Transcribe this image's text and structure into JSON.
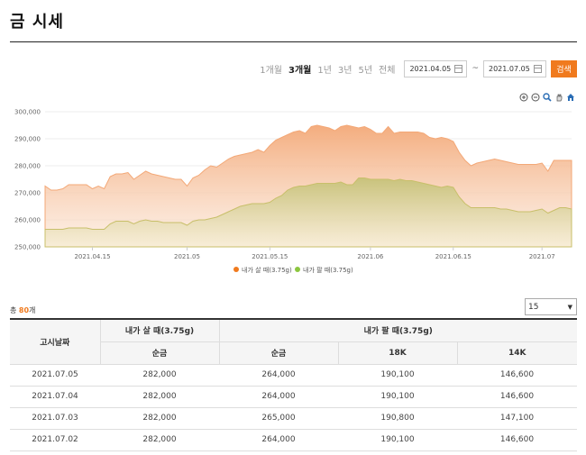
{
  "page": {
    "title": "금 시세"
  },
  "range": {
    "periods": [
      "1개월",
      "3개월",
      "1년",
      "3년",
      "5년",
      "전체"
    ],
    "active_period": "3개월",
    "start_date": "2021.04.05",
    "end_date": "2021.07.05",
    "separator": "~",
    "search_label": "검색"
  },
  "tools": [
    "zoom-in-icon",
    "zoom-out-icon",
    "magnify-icon",
    "pan-hand-icon",
    "home-icon"
  ],
  "colors": {
    "accent": "#f07a1e",
    "buy": "#f3a877",
    "sell": "#a7b84d"
  },
  "chart_data": {
    "type": "area",
    "ylim": [
      250000,
      300000
    ],
    "y_ticks": [
      "300,000",
      "290,000",
      "280,000",
      "270,000",
      "260,000",
      "250,000"
    ],
    "x_ticks": [
      {
        "label": "2021.04.15",
        "index": 8
      },
      {
        "label": "2021.05",
        "index": 24
      },
      {
        "label": "2021.05.15",
        "index": 38
      },
      {
        "label": "2021.06",
        "index": 55
      },
      {
        "label": "2021.06.15",
        "index": 69
      },
      {
        "label": "2021.07",
        "index": 84
      }
    ],
    "series": [
      {
        "name": "내가 살 때(3.75g)",
        "color": "#f3a877",
        "values": [
          272500,
          271000,
          271000,
          271500,
          273000,
          273000,
          273000,
          273000,
          271500,
          272500,
          271500,
          276000,
          277000,
          277000,
          277500,
          275000,
          276500,
          278000,
          277000,
          276500,
          276000,
          275500,
          275000,
          275000,
          272500,
          275500,
          276500,
          278500,
          280000,
          279500,
          281000,
          282500,
          283500,
          284000,
          284500,
          285000,
          286000,
          285000,
          287500,
          289500,
          290500,
          291500,
          292500,
          293000,
          292000,
          294500,
          295000,
          294500,
          294000,
          293000,
          294500,
          295000,
          294500,
          294000,
          294500,
          293500,
          292000,
          292000,
          294500,
          292000,
          292500,
          292500,
          292500,
          292500,
          292000,
          290500,
          290000,
          290500,
          290000,
          289000,
          285000,
          282000,
          280000,
          281000,
          281500,
          282000,
          282500,
          282000,
          281500,
          281000,
          280500,
          280500,
          280500,
          280500,
          281000,
          278000,
          282000,
          282000,
          282000,
          282000
        ]
      },
      {
        "name": "내가 팔 때(3.75g)",
        "color": "#a7b84d",
        "values": [
          256500,
          256500,
          256500,
          256500,
          257000,
          257000,
          257000,
          257000,
          256500,
          256500,
          256500,
          258500,
          259500,
          259500,
          259500,
          258500,
          259500,
          260000,
          259500,
          259500,
          259000,
          259000,
          259000,
          259000,
          258000,
          259500,
          260000,
          260000,
          260500,
          261000,
          262000,
          263000,
          264000,
          265000,
          265500,
          266000,
          266000,
          266000,
          266500,
          268000,
          269000,
          271000,
          272000,
          272500,
          272500,
          273000,
          273500,
          273500,
          273500,
          273500,
          274000,
          273000,
          273000,
          275500,
          275500,
          275000,
          275000,
          275000,
          275000,
          274500,
          275000,
          274500,
          274500,
          274000,
          273500,
          273000,
          272500,
          272000,
          272500,
          272000,
          268500,
          266000,
          264500,
          264500,
          264500,
          264500,
          264500,
          264000,
          264000,
          263500,
          263000,
          263000,
          263000,
          263500,
          264000,
          262500,
          263500,
          264500,
          264500,
          264000
        ]
      }
    ]
  },
  "legend": {
    "buy_label": "내가 살 때(3.75g)",
    "sell_label": "내가 팔 때(3.75g)"
  },
  "summary": {
    "prefix": "총 ",
    "count": "80",
    "suffix": "개"
  },
  "page_size": {
    "value": "15",
    "caret": "▼"
  },
  "table": {
    "headers": {
      "date": "고시날짜",
      "buy_group": "내가 살 때(3.75g)",
      "sell_group": "내가 팔 때(3.75g)",
      "buy_pure": "순금",
      "sell_pure": "순금",
      "k18": "18K",
      "k14": "14K"
    },
    "rows": [
      {
        "date": "2021.07.05",
        "buy_pure": "282,000",
        "sell_pure": "264,000",
        "k18": "190,100",
        "k14": "146,600"
      },
      {
        "date": "2021.07.04",
        "buy_pure": "282,000",
        "sell_pure": "264,000",
        "k18": "190,100",
        "k14": "146,600"
      },
      {
        "date": "2021.07.03",
        "buy_pure": "282,000",
        "sell_pure": "265,000",
        "k18": "190,800",
        "k14": "147,100"
      },
      {
        "date": "2021.07.02",
        "buy_pure": "282,000",
        "sell_pure": "264,000",
        "k18": "190,100",
        "k14": "146,600"
      }
    ]
  }
}
